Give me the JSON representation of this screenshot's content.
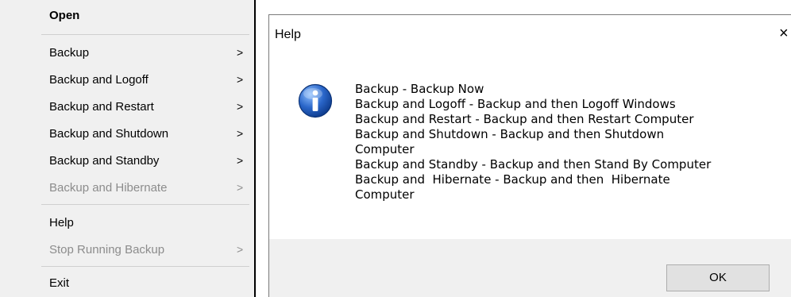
{
  "context_menu": {
    "items": [
      {
        "label": "Open",
        "bold": true,
        "disabled": false,
        "submenu": false
      },
      {
        "label": "Backup",
        "bold": false,
        "disabled": false,
        "submenu": true
      },
      {
        "label": "Backup and Logoff",
        "bold": false,
        "disabled": false,
        "submenu": true
      },
      {
        "label": "Backup and Restart",
        "bold": false,
        "disabled": false,
        "submenu": true
      },
      {
        "label": "Backup and Shutdown",
        "bold": false,
        "disabled": false,
        "submenu": true
      },
      {
        "label": "Backup and Standby",
        "bold": false,
        "disabled": false,
        "submenu": true
      },
      {
        "label": "Backup and Hibernate",
        "bold": false,
        "disabled": true,
        "submenu": true
      },
      {
        "label": "Help",
        "bold": false,
        "disabled": false,
        "submenu": false
      },
      {
        "label": "Stop Running Backup",
        "bold": false,
        "disabled": true,
        "submenu": true
      },
      {
        "label": "Exit",
        "bold": false,
        "disabled": false,
        "submenu": false
      }
    ],
    "submenu_arrow": ">"
  },
  "help_dialog": {
    "title": "Help",
    "close_glyph": "×",
    "icon": "info-icon",
    "message_lines": [
      "Backup - Backup Now",
      "Backup and Logoff - Backup and then Logoff Windows",
      "Backup and Restart - Backup and then Restart Computer",
      "Backup and Shutdown - Backup and then Shutdown",
      "Computer",
      "Backup and Standby - Backup and then Stand By Computer",
      "Backup and  Hibernate - Backup and then  Hibernate",
      "Computer"
    ],
    "ok_label": "OK"
  },
  "colors": {
    "menu_background": "#f0f0f0",
    "disabled_text": "#8c8c8c",
    "dialog_footer": "#f0f0f0",
    "info_icon_blue": "#2a66c9"
  }
}
